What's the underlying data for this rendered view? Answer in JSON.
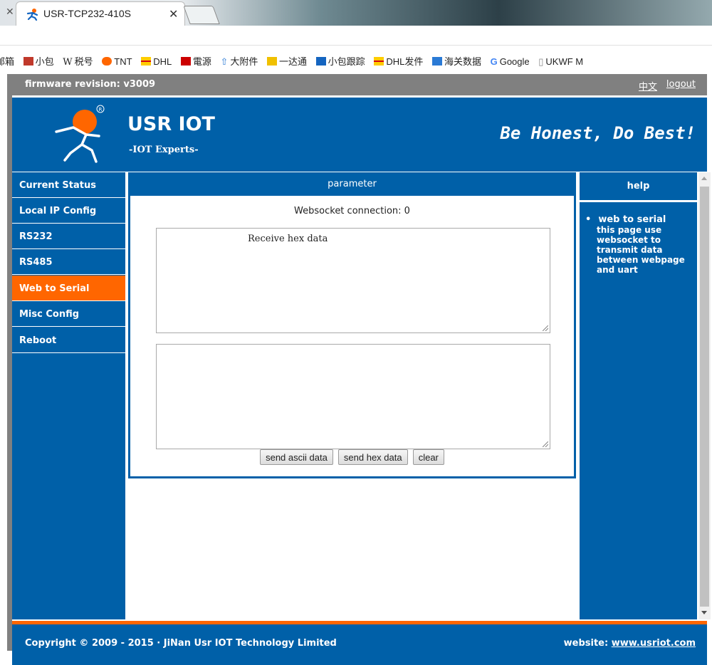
{
  "browser": {
    "tab_title": "USR-TCP232-410S",
    "bookmarks": [
      {
        "label": "邮箱",
        "icon": "mail-icon",
        "color": "#ffffff"
      },
      {
        "label": "小包",
        "icon": "bookmark-icon",
        "color": "#c0392b"
      },
      {
        "label": "税号",
        "icon": "wikipedia-icon",
        "color": "#ffffff"
      },
      {
        "label": "TNT",
        "icon": "bookmark-icon",
        "color": "#ff6600"
      },
      {
        "label": "DHL",
        "icon": "bookmark-icon",
        "color": "#ffcc00"
      },
      {
        "label": "電源",
        "icon": "bookmark-icon",
        "color": "#cc0000"
      },
      {
        "label": "大附件",
        "icon": "upload-icon",
        "color": "#2a7ad5"
      },
      {
        "label": "一达通",
        "icon": "bookmark-icon",
        "color": "#f0c000"
      },
      {
        "label": "小包跟踪",
        "icon": "bookmark-icon",
        "color": "#1565c0"
      },
      {
        "label": "DHL发件",
        "icon": "bookmark-icon",
        "color": "#ffcc00"
      },
      {
        "label": "海关数据",
        "icon": "bookmark-icon",
        "color": "#2a7ad5"
      },
      {
        "label": "Google",
        "icon": "google-icon",
        "color": "#4285f4"
      },
      {
        "label": "UKWF M",
        "icon": "page-icon",
        "color": "#888888"
      }
    ]
  },
  "topbar": {
    "firmware": "firmware revision: v3009",
    "lang": "中文",
    "logout": "logout"
  },
  "banner": {
    "brand": "USR IOT",
    "sub": "-IOT Experts-",
    "slogan": "Be Honest, Do Best!"
  },
  "sidebar": {
    "items": [
      {
        "label": "Current Status",
        "active": false
      },
      {
        "label": "Local IP Config",
        "active": false
      },
      {
        "label": "RS232",
        "active": false
      },
      {
        "label": "RS485",
        "active": false
      },
      {
        "label": "Web to Serial",
        "active": true
      },
      {
        "label": "Misc Config",
        "active": false
      },
      {
        "label": "Reboot",
        "active": false
      }
    ]
  },
  "main": {
    "header": "parameter",
    "ws_status": "Websocket connection: 0",
    "receive_placeholder": "Receive hex data",
    "send_value": "",
    "buttons": {
      "send_ascii": "send ascii data",
      "send_hex": "send hex data",
      "clear": "clear"
    }
  },
  "help": {
    "header": "help",
    "title": "web to serial",
    "text": "this page use websocket to transmit data between webpage and uart"
  },
  "footer": {
    "copyright": "Copyright © 2009 - 2015 · JiNan Usr IOT Technology Limited",
    "website_label": "website:",
    "website_link": "www.usriot.com"
  },
  "colors": {
    "brand_blue": "#0060a8",
    "accent_orange": "#ff6600",
    "topbar_gray": "#808080"
  }
}
